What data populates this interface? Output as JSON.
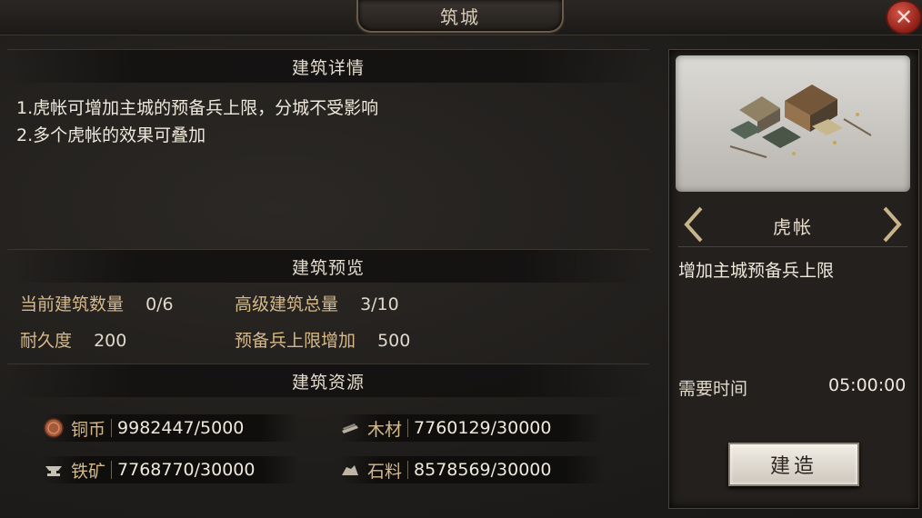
{
  "window": {
    "title": "筑城",
    "close_label": "✕"
  },
  "details": {
    "header": "建筑详情",
    "lines": [
      "1.虎帐可增加主城的预备兵上限，分城不受影响",
      "2.多个虎帐的效果可叠加"
    ]
  },
  "preview": {
    "header": "建筑预览",
    "current_count_label": "当前建筑数量",
    "current_count_value": "0/6",
    "advanced_total_label": "高级建筑总量",
    "advanced_total_value": "3/10",
    "durability_label": "耐久度",
    "durability_value": "200",
    "reserve_label": "预备兵上限增加",
    "reserve_value": "500"
  },
  "resources": {
    "header": "建筑资源",
    "items": [
      {
        "name": "铜币",
        "value": "9982447/5000",
        "icon": "copper-coin-icon"
      },
      {
        "name": "木材",
        "value": "7760129/30000",
        "icon": "wood-icon"
      },
      {
        "name": "铁矿",
        "value": "7768770/30000",
        "icon": "iron-anvil-icon"
      },
      {
        "name": "石料",
        "value": "8578569/30000",
        "icon": "stone-icon"
      }
    ]
  },
  "building": {
    "name": "虎帐",
    "description": "增加主城预备兵上限",
    "time_label": "需要时间",
    "time_value": "05:00:00",
    "build_label": "建造"
  },
  "colors": {
    "accent": "#d6b98a",
    "close": "#b8382c"
  }
}
